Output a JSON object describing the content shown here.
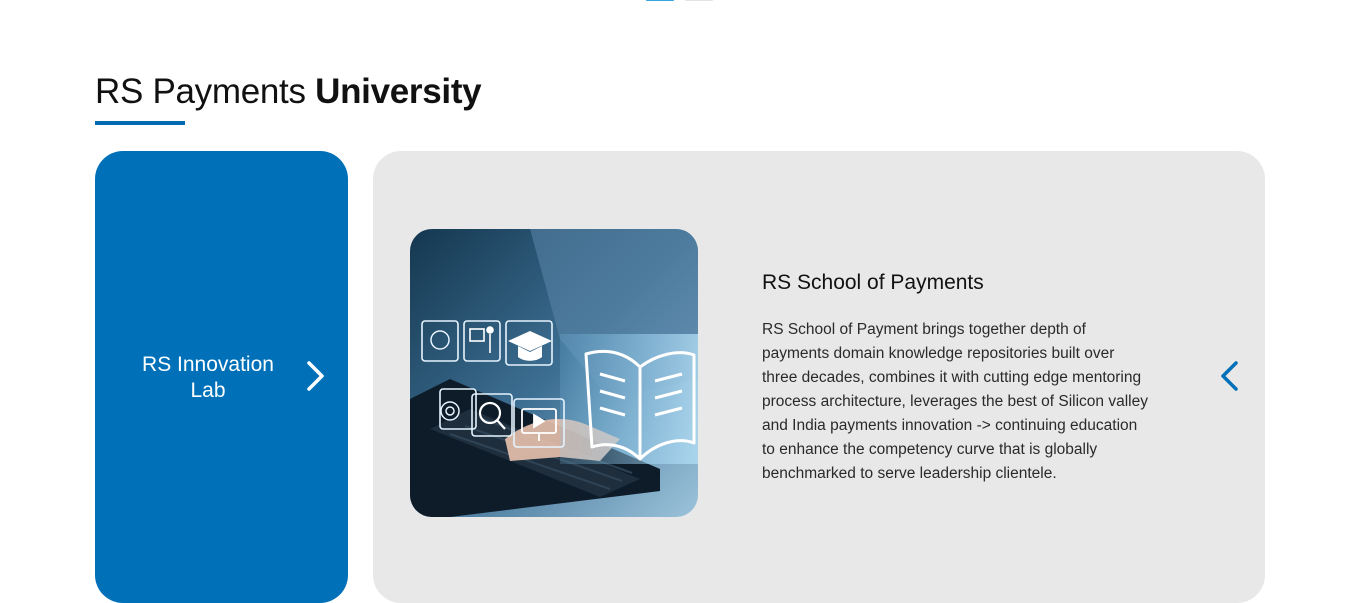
{
  "title": {
    "regular": "RS Payments",
    "bold": "University"
  },
  "colors": {
    "accent_blue": "#0070b8",
    "card_grey": "#e8e8e8",
    "pager_active": "#35a7de"
  },
  "lab_card": {
    "label": "RS Innovation Lab",
    "icon": "chevron-right-icon"
  },
  "school_card": {
    "title": "RS School of Payments",
    "description": "RS School of Payment brings together depth of payments domain knowledge repositories built over three decades, combines it with cutting edge mentoring process architecture, leverages the best of Silicon valley and India payments innovation -> continuing education to enhance the competency curve that is globally benchmarked to serve leadership clientele.",
    "image_icons": [
      "brain-icon",
      "presentation-icon",
      "graduation-cap-icon",
      "open-book-icon",
      "target-icon",
      "magnifier-icon",
      "video-icon"
    ],
    "prev_icon": "chevron-left-icon"
  }
}
